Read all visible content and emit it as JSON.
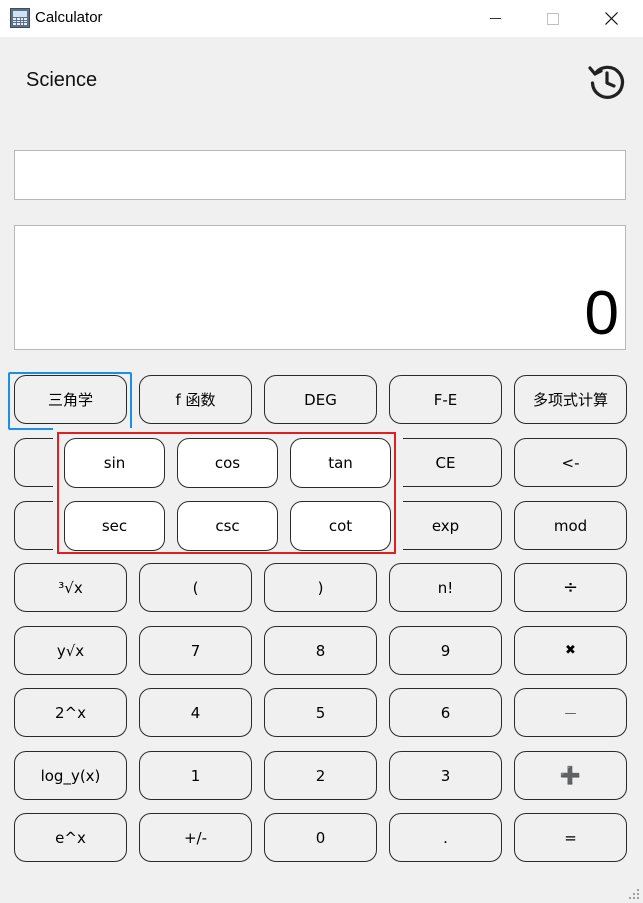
{
  "window": {
    "title": "Calculator"
  },
  "header": {
    "mode": "Science",
    "history_icon": "history-icon"
  },
  "display": {
    "expression": "",
    "value": "0"
  },
  "toolbar": {
    "trig": "三角学",
    "func": "f 函数",
    "angle": "DEG",
    "fe": "F-E",
    "poly": "多项式计算"
  },
  "trig_popup": {
    "row1": [
      "sin",
      "cos",
      "tan"
    ],
    "row2": [
      "sec",
      "csc",
      "cot"
    ]
  },
  "keys": {
    "ce": "CE",
    "back": "<-",
    "exp": "exp",
    "mod": "mod",
    "cbrt": "³√x",
    "lparen": "(",
    "rparen": ")",
    "fact": "n!",
    "div": "÷",
    "yroot": "y√x",
    "n7": "7",
    "n8": "8",
    "n9": "9",
    "mul": "✖",
    "pow2": "2^x",
    "n4": "4",
    "n5": "5",
    "n6": "6",
    "sub": "—",
    "logy": "log_y(x)",
    "n1": "1",
    "n2": "2",
    "n3": "3",
    "add": "➕",
    "epow": "e^x",
    "neg": "+/-",
    "n0": "0",
    "dot": ".",
    "eq": "="
  }
}
